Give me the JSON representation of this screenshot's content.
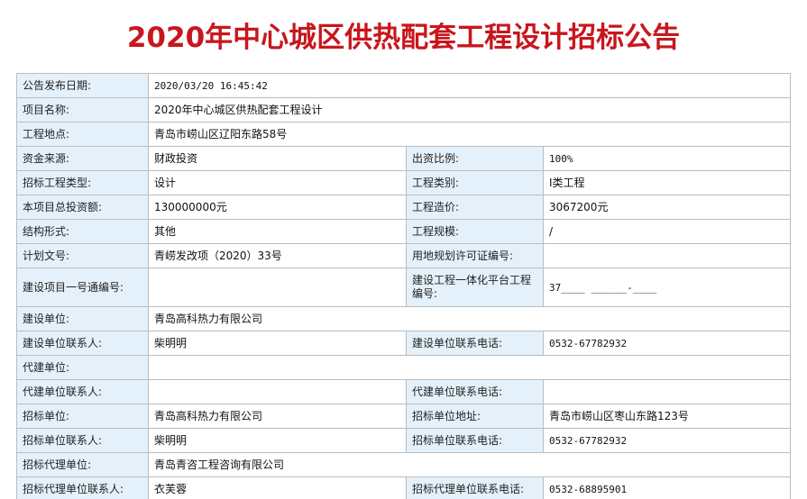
{
  "title": "2020年中心城区供热配套工程设计招标公告",
  "colors": {
    "title": "#c8161d",
    "label_bg": "#e5f1fa",
    "border": "#bcbcbc"
  },
  "fields": {
    "publish_date": {
      "label": "公告发布日期:",
      "value": "2020/03/20 16:45:42"
    },
    "project_name": {
      "label": "项目名称:",
      "value": "2020年中心城区供热配套工程设计"
    },
    "location": {
      "label": "工程地点:",
      "value": "青岛市崂山区辽阳东路58号"
    },
    "fund_source": {
      "label": "资金来源:",
      "value": "财政投资"
    },
    "fund_ratio": {
      "label": "出资比例:",
      "value": "100%"
    },
    "tender_type": {
      "label": "招标工程类型:",
      "value": "设计"
    },
    "project_category": {
      "label": "工程类别:",
      "value": "Ⅰ类工程"
    },
    "total_investment": {
      "label": "本项目总投资额:",
      "value": "130000000元"
    },
    "project_cost": {
      "label": "工程造价:",
      "value": "3067200元"
    },
    "structure": {
      "label": "结构形式:",
      "value": "其他"
    },
    "scale": {
      "label": "工程规模:",
      "value": "/"
    },
    "plan_doc": {
      "label": "计划文号:",
      "value": "青崂发改项（2020）33号"
    },
    "land_permit": {
      "label": "用地规划许可证编号:",
      "value": ""
    },
    "project_code": {
      "label": "建设项目一号通编号:",
      "value": ""
    },
    "platform_code": {
      "label": "建设工程一体化平台工程编号:",
      "value": "37____ ______-____"
    },
    "builder": {
      "label": "建设单位:",
      "value": "青岛高科热力有限公司"
    },
    "builder_contact": {
      "label": "建设单位联系人:",
      "value": "柴明明"
    },
    "builder_phone": {
      "label": "建设单位联系电话:",
      "value": "0532-67782932"
    },
    "agent_builder": {
      "label": "代建单位:",
      "value": ""
    },
    "agent_builder_contact": {
      "label": "代建单位联系人:",
      "value": ""
    },
    "agent_builder_phone": {
      "label": "代建单位联系电话:",
      "value": ""
    },
    "tenderer": {
      "label": "招标单位:",
      "value": "青岛高科热力有限公司"
    },
    "tenderer_address": {
      "label": "招标单位地址:",
      "value": "青岛市崂山区枣山东路123号"
    },
    "tenderer_contact": {
      "label": "招标单位联系人:",
      "value": "柴明明"
    },
    "tenderer_phone": {
      "label": "招标单位联系电话:",
      "value": "0532-67782932"
    },
    "tender_agent": {
      "label": "招标代理单位:",
      "value": "青岛青咨工程咨询有限公司"
    },
    "tender_agent_contact": {
      "label": "招标代理单位联系人:",
      "value": "衣芙蓉"
    },
    "tender_agent_phone": {
      "label": "招标代理单位联系电话:",
      "value": "0532-68895901"
    }
  }
}
